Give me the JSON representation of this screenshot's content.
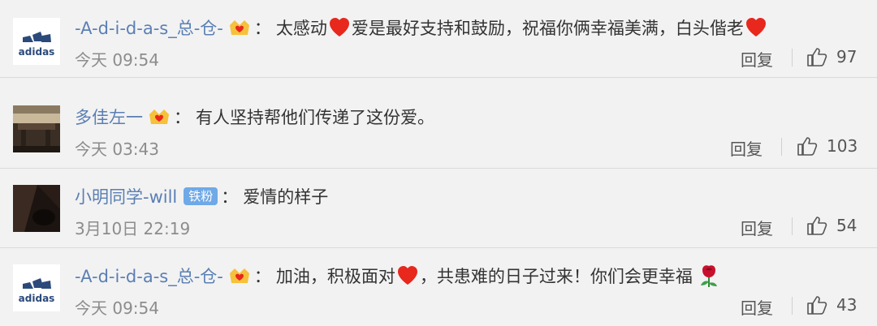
{
  "comments": [
    {
      "username": "-A-d-i-d-a-s_总-仓-",
      "text_parts": [
        "太感动",
        "爱是最好支持和鼓励，祝福你俩幸福美满，白头偕老"
      ],
      "time": "今天 09:54",
      "reply_label": "回复",
      "likes": "97",
      "avatar": "adidas-logo"
    },
    {
      "username": "多佳左一",
      "text_parts": [
        "有人坚持帮他们传递了这份爱。"
      ],
      "time": "今天 03:43",
      "reply_label": "回复",
      "likes": "103",
      "avatar": "photo-room"
    },
    {
      "username": "小明同学-will",
      "badge": "铁粉",
      "text_parts": [
        "爱情的样子"
      ],
      "time": "3月10日 22:19",
      "reply_label": "回复",
      "likes": "54",
      "avatar": "photo-dark"
    },
    {
      "username": "-A-d-i-d-a-s_总-仓-",
      "text_parts": [
        "加油，积极面对",
        "，共患难的日子过来！你们会更幸福"
      ],
      "time": "今天 09:54",
      "reply_label": "回复",
      "likes": "43",
      "avatar": "adidas-logo"
    }
  ],
  "colon": "：",
  "logo_text": "adidas",
  "colors": {
    "username": "#5a7fb4",
    "badge": "#6fa9e7",
    "heart": "#e8271d",
    "adidas": "#2b4a7a"
  }
}
